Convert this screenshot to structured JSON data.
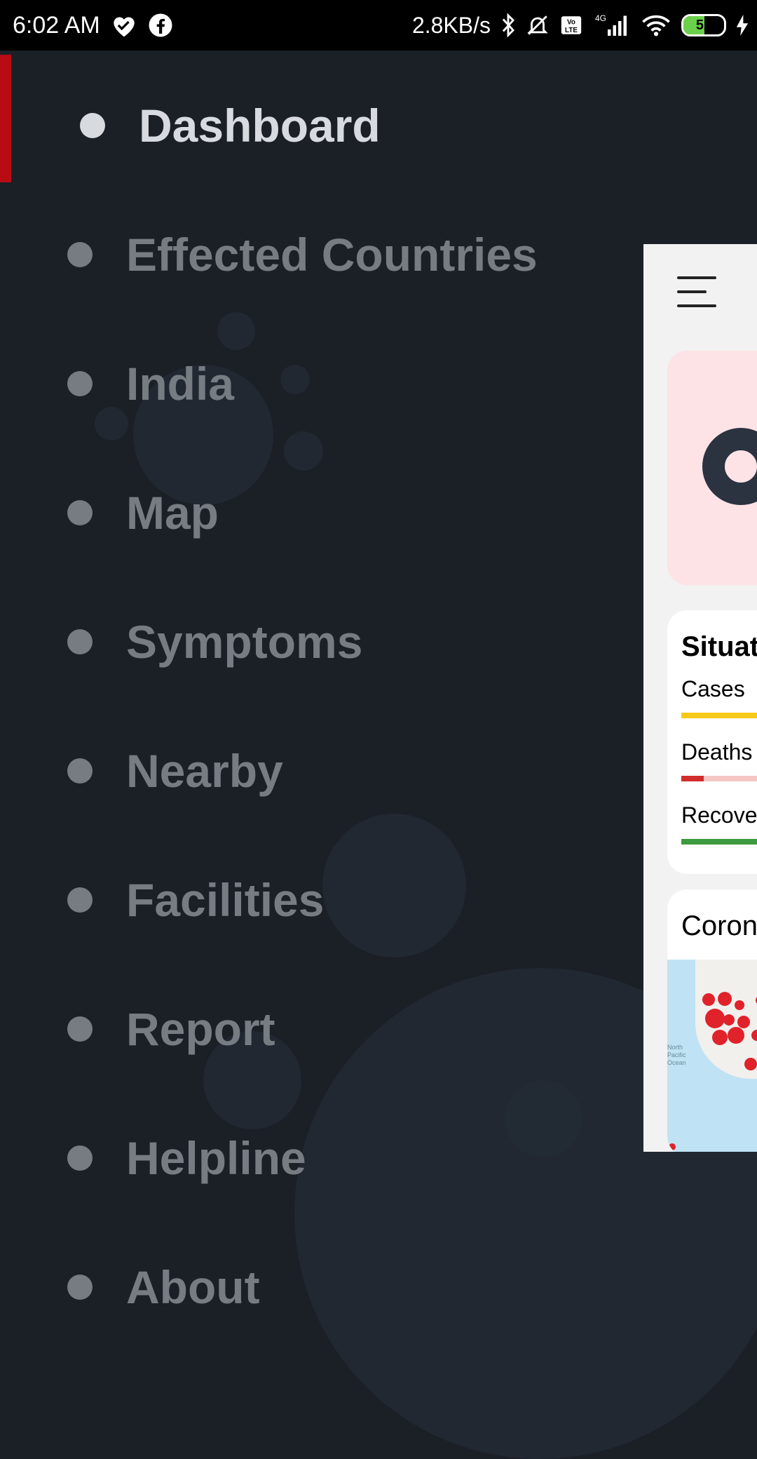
{
  "status_bar": {
    "time": "6:02 AM",
    "net_speed": "2.8KB/s",
    "network_type": "4G",
    "volte": "Vo LTE",
    "battery_level": "52"
  },
  "drawer": {
    "items": [
      {
        "label": "Dashboard",
        "active": true
      },
      {
        "label": "Effected Countries",
        "active": false
      },
      {
        "label": "India",
        "active": false
      },
      {
        "label": "Map",
        "active": false
      },
      {
        "label": "Symptoms",
        "active": false
      },
      {
        "label": "Nearby",
        "active": false
      },
      {
        "label": "Facilities",
        "active": false
      },
      {
        "label": "Report",
        "active": false
      },
      {
        "label": "Helpline",
        "active": false
      },
      {
        "label": "About",
        "active": false
      }
    ]
  },
  "preview": {
    "situation_title": "Situati",
    "rows": [
      {
        "label": "Cases",
        "color": "#f5c917"
      },
      {
        "label": "Deaths",
        "color": "#d22d2d"
      },
      {
        "label": "Recove",
        "color": "#3e9a3e"
      }
    ],
    "map_title": "Corona",
    "ocean_label": "North Pacific Ocean"
  },
  "colors": {
    "drawer_bg": "#1b1f26",
    "accent": "#b80b14",
    "active_text": "#d7dbe0",
    "inactive_text": "#777c83"
  }
}
